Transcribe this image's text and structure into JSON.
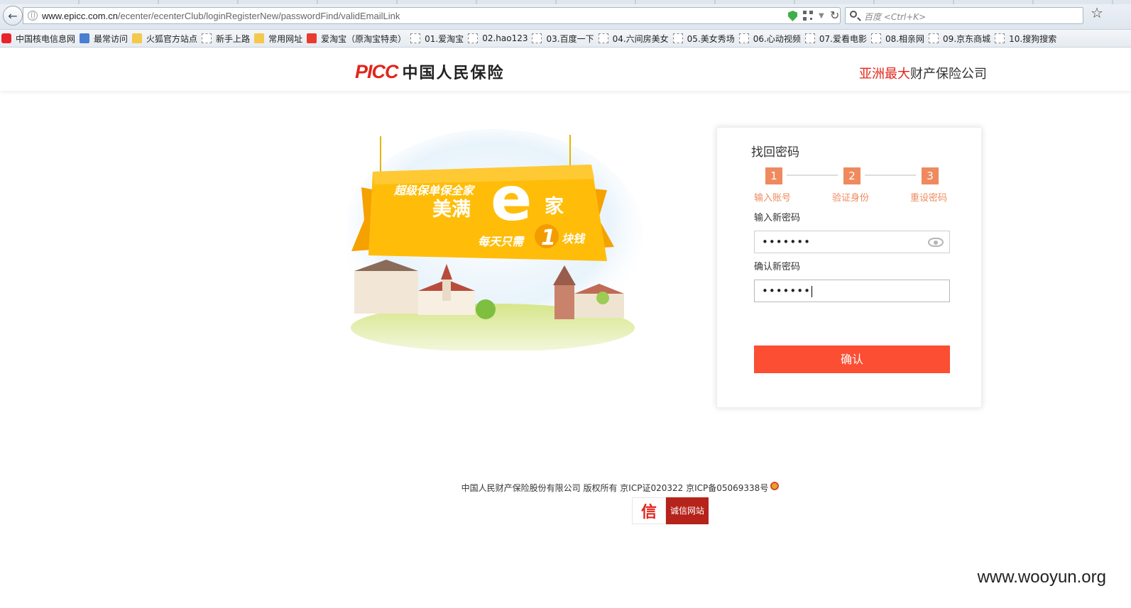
{
  "browser": {
    "url_host": "www.epicc.com.cn",
    "url_path": "/ecenter/ecenterClub/loginRegisterNew/passwordFind/validEmailLink",
    "search_placeholder": "百度 <Ctrl+K>",
    "bookmarks": [
      {
        "label": "中国核电信息网",
        "icon": "red-logo-icon"
      },
      {
        "label": "最常访问",
        "icon": "frequent-icon"
      },
      {
        "label": "火狐官方站点",
        "icon": "folder-icon"
      },
      {
        "label": "新手上路",
        "icon": "page-icon"
      },
      {
        "label": "常用网址",
        "icon": "folder-icon"
      },
      {
        "label": "爱淘宝（原淘宝特卖）",
        "icon": "taobao-icon"
      },
      {
        "label": "01.爱淘宝",
        "icon": "page-icon"
      },
      {
        "label": "02.hao123",
        "icon": "page-icon"
      },
      {
        "label": "03.百度一下",
        "icon": "page-icon"
      },
      {
        "label": "04.六间房美女",
        "icon": "page-icon"
      },
      {
        "label": "05.美女秀场",
        "icon": "page-icon"
      },
      {
        "label": "06.心动视频",
        "icon": "page-icon"
      },
      {
        "label": "07.爱看电影",
        "icon": "page-icon"
      },
      {
        "label": "08.相亲网",
        "icon": "page-icon"
      },
      {
        "label": "09.京东商城",
        "icon": "page-icon"
      },
      {
        "label": "10.搜狗搜索",
        "icon": "page-icon"
      }
    ]
  },
  "header": {
    "logo_mark": "PICC",
    "logo_cn": "中国人民保险",
    "slogan_highlight": "亚洲最大",
    "slogan_rest": "财产保险公司"
  },
  "banner": {
    "line1": "超级保单保全家",
    "line2": "美满",
    "big_letter": "e",
    "line3": "家",
    "line4a": "每天只需",
    "badge_number": "1",
    "line4b": "块钱"
  },
  "form": {
    "title": "找回密码",
    "steps": [
      {
        "number": "1",
        "label": "输入账号"
      },
      {
        "number": "2",
        "label": "验证身份"
      },
      {
        "number": "3",
        "label": "重设密码"
      }
    ],
    "new_password_label": "输入新密码",
    "new_password_value": "•••••••",
    "confirm_password_label": "确认新密码",
    "confirm_password_value": "•••••••",
    "submit_label": "确认"
  },
  "footer": {
    "copyright": "中国人民财产保险股份有限公司 版权所有 京ICP证020322 京ICP备05069338号",
    "trust_logo_char": "信",
    "trust_label": "诚信网站"
  },
  "watermark": "www.wooyun.org",
  "colors": {
    "brand_red": "#e2251b",
    "step_orange": "#ef8a5e",
    "button_red": "#fb4e33"
  }
}
